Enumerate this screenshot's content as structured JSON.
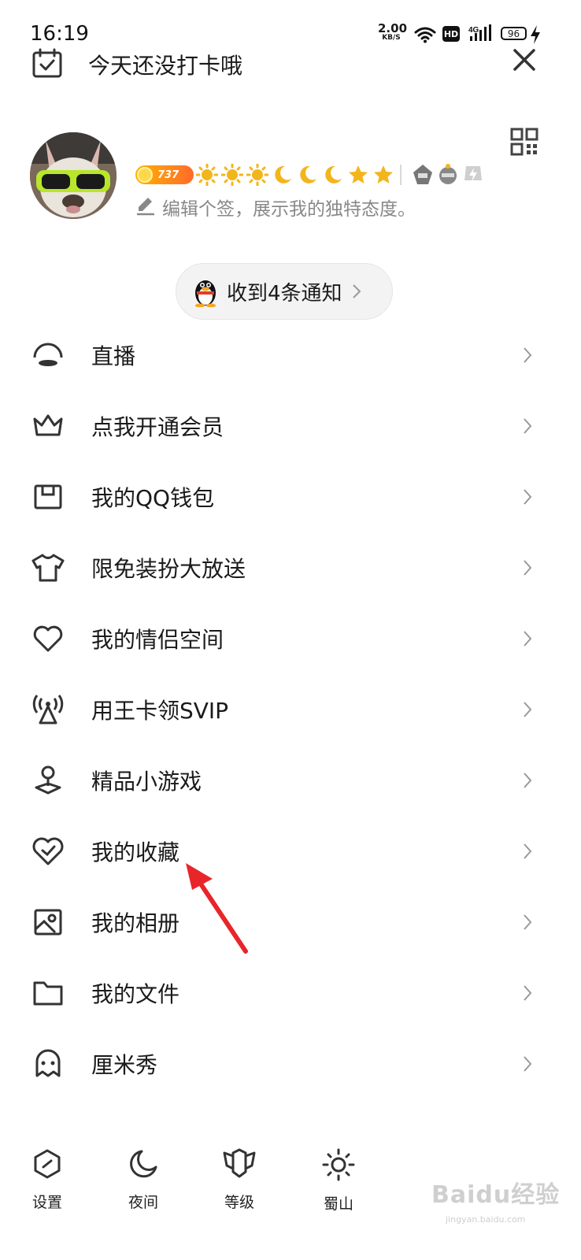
{
  "status_bar": {
    "time": "16:19",
    "speed_value": "2.00",
    "speed_unit": "KB/S",
    "hd": "HD",
    "network": "4G",
    "battery": "96"
  },
  "header": {
    "checkin_text": "今天还没打卡哦"
  },
  "profile": {
    "level_number": "737",
    "signature_placeholder": "编辑个签，展示我的独特态度。"
  },
  "notification": {
    "text": "收到4条通知"
  },
  "menu": [
    {
      "label": "直播",
      "icon": "live-icon"
    },
    {
      "label": "点我开通会员",
      "icon": "crown-icon"
    },
    {
      "label": "我的QQ钱包",
      "icon": "wallet-icon"
    },
    {
      "label": "限免装扮大放送",
      "icon": "shirt-icon"
    },
    {
      "label": "我的情侣空间",
      "icon": "heart-icon"
    },
    {
      "label": "用王卡领SVIP",
      "icon": "antenna-icon"
    },
    {
      "label": "精品小游戏",
      "icon": "game-icon"
    },
    {
      "label": "我的收藏",
      "icon": "favorite-icon"
    },
    {
      "label": "我的相册",
      "icon": "album-icon"
    },
    {
      "label": "我的文件",
      "icon": "folder-icon"
    },
    {
      "label": "厘米秀",
      "icon": "cmshow-icon"
    }
  ],
  "bottom_bar": [
    {
      "label": "设置",
      "icon": "settings-icon"
    },
    {
      "label": "夜间",
      "icon": "moon-icon"
    },
    {
      "label": "等级",
      "icon": "level-icon"
    },
    {
      "label": "蜀山",
      "icon": "sun-icon"
    }
  ],
  "watermark": {
    "text": "Baidu经验",
    "url": "jingyan.baidu.com"
  },
  "colors": {
    "annotation_arrow": "#e8262a",
    "coin_gradient_start": "#ffb400",
    "coin_gradient_end": "#ff6a2a",
    "level_icon": "#f3b51c"
  }
}
